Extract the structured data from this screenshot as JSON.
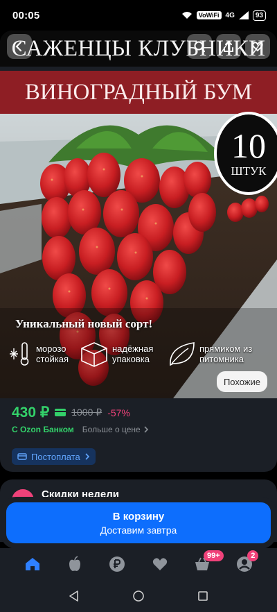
{
  "status_bar": {
    "time": "00:05",
    "wifi_label": "VoWiFi",
    "network": "4G",
    "battery": "93"
  },
  "product_image": {
    "banner_line_1": "САЖЕНЦЫ КЛУБНИКИ",
    "banner_line_2": "ВИНОГРАДНЫЙ БУМ",
    "count_number": "10",
    "count_unit": "ШТУК",
    "tagline": "Уникальный новый сорт!",
    "features": [
      {
        "line1": "морозо",
        "line2": "стойкая",
        "icon": "thermometer-snowflake-icon"
      },
      {
        "line1": "надёжная",
        "line2": "упаковка",
        "icon": "box-icon"
      },
      {
        "line1": "прямиком из",
        "line2": "питомника",
        "icon": "leaf-icon"
      }
    ],
    "similar_label": "Похожие"
  },
  "price": {
    "current": "430 ₽",
    "old": "1000 ₽",
    "discount": "-57%",
    "bank_label": "С Ozon Банком",
    "more_label": "Больше о цене",
    "postpay_label": "Постоплата"
  },
  "deals": {
    "title": "Скидки недели"
  },
  "cart": {
    "title": "В корзину",
    "subtitle": "Доставим завтра"
  },
  "bottom_nav": {
    "cart_badge": "99+",
    "profile_badge": "2"
  },
  "colors": {
    "accent_blue": "#0d6efd",
    "price_green": "#33d16a",
    "discount_pink": "#f0427a",
    "card_bg": "#1b1f26"
  }
}
